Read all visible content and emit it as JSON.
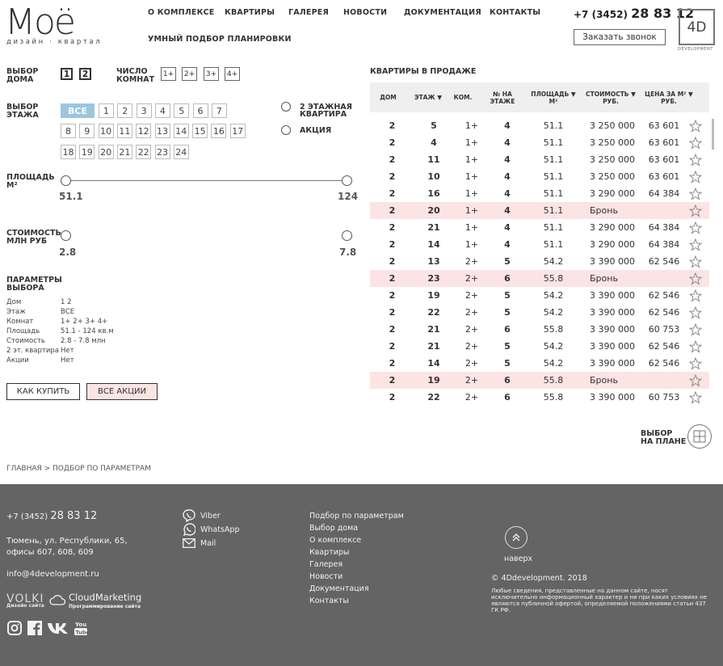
{
  "header": {
    "logo_text": "Моё",
    "logo_sub": "дизайн · квартал",
    "nav": [
      "О КОМПЛЕКСЕ",
      "КВАРТИРЫ",
      "ГАЛЕРЕЯ",
      "НОВОСТИ",
      "ДОКУМЕНТАЦИЯ",
      "КОНТАКТЫ",
      "УМНЫЙ ПОДБОР ПЛАНИРОВКИ"
    ],
    "phone_prefix": "+7 (3452)",
    "phone_main": "28 83 12",
    "callback": "Заказать звонок",
    "dev_logo": "4D",
    "dev_sub": "DEVELOPMENT"
  },
  "filters": {
    "house_label_1": "ВЫБОР",
    "house_label_2": "ДОМА",
    "houses": [
      "1",
      "2"
    ],
    "rooms_label_1": "ЧИСЛО",
    "rooms_label_2": "КОМНАТ",
    "rooms": [
      "1+",
      "2+",
      "3+",
      "4+"
    ],
    "floor_label_1": "ВЫБОР",
    "floor_label_2": "ЭТАЖА",
    "floor_all": "ВСЕ",
    "floors": [
      "1",
      "2",
      "3",
      "4",
      "5",
      "6",
      "7",
      "8",
      "9",
      "10",
      "11",
      "12",
      "13",
      "14",
      "15",
      "16",
      "17",
      "18",
      "19",
      "20",
      "21",
      "22",
      "23",
      "24"
    ],
    "opt_two_floor_1": "2 ЭТАЖНАЯ",
    "opt_two_floor_2": "КВАРТИРА",
    "opt_action": "АКЦИЯ",
    "area_label_1": "ПЛОЩАДЬ",
    "area_label_2": "М²",
    "area_min": "51.1",
    "area_max": "124",
    "price_label_1": "СТОИМОСТЬ",
    "price_label_2": "МЛН РУБ",
    "price_min": "2.8",
    "price_max": "7.8",
    "params_label_1": "ПАРАМЕТРЫ",
    "params_label_2": "ВЫБОРА",
    "params": [
      {
        "k": "Дом",
        "v": "1 2"
      },
      {
        "k": "Этаж",
        "v": "ВСЕ"
      },
      {
        "k": "Комнат",
        "v": "1+ 2+ 3+ 4+"
      },
      {
        "k": "Площадь",
        "v": "51.1 - 124 кв.м"
      },
      {
        "k": "Стоимость",
        "v": "2.8 - 7.8 млн"
      },
      {
        "k": "2 эт. квартира",
        "v": "Нет"
      },
      {
        "k": "Акции",
        "v": "Нет"
      }
    ],
    "btn_buy": "КАК КУПИТЬ",
    "btn_actions": "ВСЕ АКЦИИ"
  },
  "table": {
    "title": "КВАРТИРЫ В ПРОДАЖЕ",
    "headers": [
      "ДОМ",
      "ЭТАЖ ▼",
      "КОМ.",
      "№ НА ЭТАЖЕ",
      "ПЛОЩАДЬ ▼ М²",
      "СТОИМОСТЬ ▼ РУБ.",
      "ЦЕНА ЗА М² ▼ РУБ."
    ],
    "rows": [
      {
        "house": "2",
        "floor": "5",
        "rooms": "1+",
        "num": "4",
        "area": "51.1",
        "price": "3 250 000",
        "ppm": "63 601",
        "reserved": false
      },
      {
        "house": "2",
        "floor": "4",
        "rooms": "1+",
        "num": "4",
        "area": "51.1",
        "price": "3 250 000",
        "ppm": "63 601",
        "reserved": false
      },
      {
        "house": "2",
        "floor": "11",
        "rooms": "1+",
        "num": "4",
        "area": "51.1",
        "price": "3 250 000",
        "ppm": "63 601",
        "reserved": false
      },
      {
        "house": "2",
        "floor": "10",
        "rooms": "1+",
        "num": "4",
        "area": "51.1",
        "price": "3 250 000",
        "ppm": "63 601",
        "reserved": false
      },
      {
        "house": "2",
        "floor": "16",
        "rooms": "1+",
        "num": "4",
        "area": "51.1",
        "price": "3 290 000",
        "ppm": "64 384",
        "reserved": false
      },
      {
        "house": "2",
        "floor": "20",
        "rooms": "1+",
        "num": "4",
        "area": "51.1",
        "price": "Бронь",
        "ppm": "",
        "reserved": true
      },
      {
        "house": "2",
        "floor": "21",
        "rooms": "1+",
        "num": "4",
        "area": "51.1",
        "price": "3 290 000",
        "ppm": "64 384",
        "reserved": false
      },
      {
        "house": "2",
        "floor": "14",
        "rooms": "1+",
        "num": "4",
        "area": "51.1",
        "price": "3 290 000",
        "ppm": "64 384",
        "reserved": false
      },
      {
        "house": "2",
        "floor": "13",
        "rooms": "2+",
        "num": "5",
        "area": "54.2",
        "price": "3 390 000",
        "ppm": "62 546",
        "reserved": false
      },
      {
        "house": "2",
        "floor": "23",
        "rooms": "2+",
        "num": "6",
        "area": "55.8",
        "price": "Бронь",
        "ppm": "",
        "reserved": true
      },
      {
        "house": "2",
        "floor": "19",
        "rooms": "2+",
        "num": "5",
        "area": "54.2",
        "price": "3 390 000",
        "ppm": "62 546",
        "reserved": false
      },
      {
        "house": "2",
        "floor": "22",
        "rooms": "2+",
        "num": "5",
        "area": "54.2",
        "price": "3 390 000",
        "ppm": "62 546",
        "reserved": false
      },
      {
        "house": "2",
        "floor": "21",
        "rooms": "2+",
        "num": "6",
        "area": "55.8",
        "price": "3 390 000",
        "ppm": "60 753",
        "reserved": false
      },
      {
        "house": "2",
        "floor": "21",
        "rooms": "2+",
        "num": "5",
        "area": "54.2",
        "price": "3 390 000",
        "ppm": "62 546",
        "reserved": false
      },
      {
        "house": "2",
        "floor": "14",
        "rooms": "2+",
        "num": "5",
        "area": "54.2",
        "price": "3 390 000",
        "ppm": "62 546",
        "reserved": false
      },
      {
        "house": "2",
        "floor": "19",
        "rooms": "2+",
        "num": "6",
        "area": "55.8",
        "price": "Бронь",
        "ppm": "",
        "reserved": true
      },
      {
        "house": "2",
        "floor": "22",
        "rooms": "2+",
        "num": "6",
        "area": "55.8",
        "price": "3 390 000",
        "ppm": "60 753",
        "reserved": false
      }
    ],
    "plan_label_1": "ВЫБОР",
    "plan_label_2": "НА ПЛАНЕ"
  },
  "breadcrumbs": "ГЛАВНАЯ > ПОДБОР ПО ПАРАМЕТРАМ",
  "footer": {
    "phone_prefix": "+7 (3452)",
    "phone_main": "28 83 12",
    "address_1": "Тюмень, ул. Республики, 65,",
    "address_2": "офисы 607, 608, 609",
    "email": "info@4development.ru",
    "volki": "VOLKI",
    "volki_sub": "Дизайн сайта",
    "cloud": "CloudMarketing",
    "cloud_sub": "Программирование сайта",
    "messengers": [
      "Viber",
      "WhatsApp",
      "Mail"
    ],
    "links": [
      "Подбор по параметрам",
      "Выбор дома",
      "О комплексе",
      "Квартиры",
      "Галерея",
      "Новости",
      "Документация",
      "Контакты"
    ],
    "up_label": "наверх",
    "copyright": "© 4Ddevelopment. 2018",
    "legal": "Любые сведения, представленные на данном сайте, носят исключительно информационный характер и ни при каких условиях не являются публичной офертой, определяемой положениями статьи 437 ГК РФ."
  },
  "colors": {
    "accent_blue": "#9cc6de",
    "reserved_pink": "#fbe4e3",
    "footer_bg": "#646464"
  }
}
